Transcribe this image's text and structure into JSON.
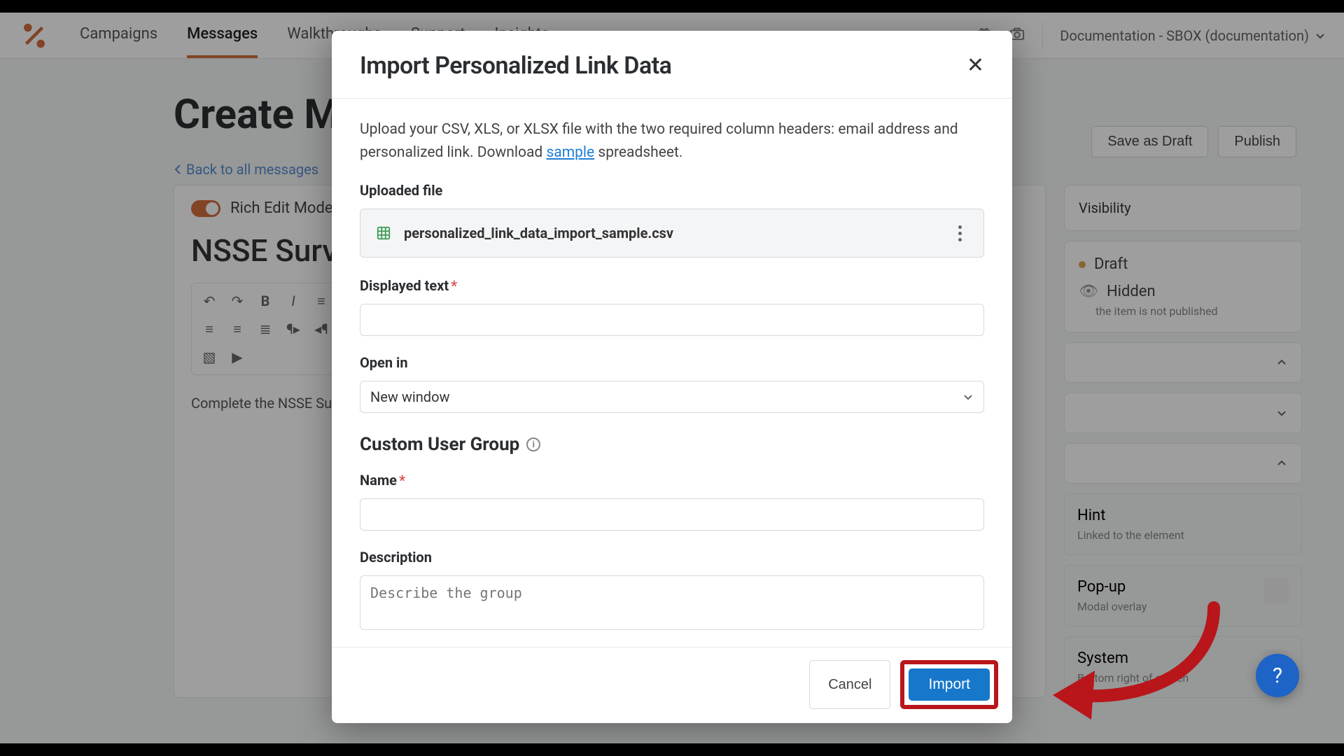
{
  "topbar": {
    "nav": {
      "campaigns": "Campaigns",
      "messages": "Messages",
      "walkthroughs": "Walkthroughs",
      "support": "Support",
      "insights": "Insights"
    },
    "active": "messages",
    "account": "Documentation - SBOX (documentation)"
  },
  "page": {
    "title": "Create Message",
    "back": "Back to all messages",
    "save_draft": "Save as Draft",
    "publish": "Publish"
  },
  "editor": {
    "rich_toggle": "Rich Edit Mode On",
    "doc_title": "NSSE Survey",
    "body": "Complete the NSSE Survey"
  },
  "side": {
    "visibility_tab": "Visibility",
    "status": "Draft",
    "hidden": "Hidden",
    "hidden_sub": "the item is not published",
    "hint": "Hint",
    "hint_sub": "Linked to the element",
    "popup": "Pop-up",
    "popup_sub": "Modal overlay",
    "sys": "System",
    "sys_sub": "Bottom right of screen"
  },
  "modal": {
    "title": "Import Personalized Link Data",
    "intro_a": "Upload your CSV, XLS, or XLSX file with the two required column headers: email address and personalized link. Download ",
    "intro_link": "sample",
    "intro_b": " spreadsheet.",
    "uploaded_label": "Uploaded file",
    "filename": "personalized_link_data_import_sample.csv",
    "displayed_label": "Displayed text",
    "openin_label": "Open in",
    "openin_value": "New window",
    "group_head": "Custom User Group",
    "name_label": "Name",
    "desc_label": "Description",
    "desc_placeholder": "Describe the group",
    "cancel": "Cancel",
    "import": "Import"
  },
  "colors": {
    "accent": "#1677cb",
    "highlight": "#b8161a",
    "brand": "#e46a2a"
  }
}
